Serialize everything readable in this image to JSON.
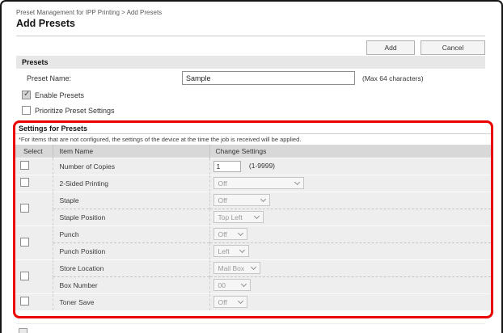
{
  "breadcrumb": "Preset Management for IPP Printing > Add Presets",
  "page_title": "Add Presets",
  "toolbar": {
    "add_label": "Add",
    "cancel_label": "Cancel"
  },
  "presets": {
    "section_title": "Presets",
    "name_label": "Preset Name:",
    "name_value": "Sample",
    "name_hint": "(Max 64 characters)",
    "enable_label": "Enable Presets",
    "prioritize_label": "Prioritize Preset Settings"
  },
  "settings": {
    "section_title": "Settings for Presets",
    "note": "*For items that are not configured, the settings of the device at the time the job is received will be applied.",
    "headers": {
      "select": "Select",
      "item": "Item Name",
      "change": "Change Settings"
    },
    "rows": [
      {
        "label": "Number of Copies",
        "value": "1",
        "hint": "(1-9999)"
      },
      {
        "label": "2-Sided Printing",
        "value": "Off"
      },
      {
        "label": "Staple",
        "value": "Off"
      },
      {
        "label": "Staple Position",
        "value": "Top Left"
      },
      {
        "label": "Punch",
        "value": "Off"
      },
      {
        "label": "Punch Position",
        "value": "Left"
      },
      {
        "label": "Store Location",
        "value": "Mail Box"
      },
      {
        "label": "Box Number",
        "value": "00"
      },
      {
        "label": "Toner Save",
        "value": "Off"
      }
    ]
  },
  "colors": {
    "highlight_border": "#ea0000",
    "table_header_bg": "#d8d8d8",
    "row_bg": "#eeeeee",
    "section_bg": "#e7e7e7"
  }
}
